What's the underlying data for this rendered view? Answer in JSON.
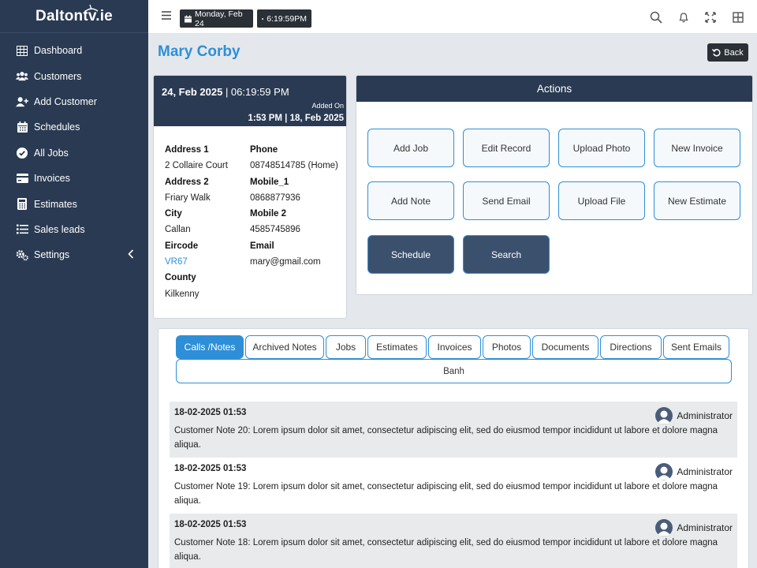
{
  "brand": {
    "name": "Daltontv.ie"
  },
  "sidebar": {
    "items": [
      {
        "label": "Dashboard",
        "icon": "table-icon"
      },
      {
        "label": "Customers",
        "icon": "users-icon"
      },
      {
        "label": "Add Customer",
        "icon": "user-plus-icon"
      },
      {
        "label": "Schedules",
        "icon": "calendar-icon"
      },
      {
        "label": "All Jobs",
        "icon": "check-circle-icon"
      },
      {
        "label": "Invoices",
        "icon": "credit-card-icon"
      },
      {
        "label": "Estimates",
        "icon": "calculator-icon"
      },
      {
        "label": "Sales leads",
        "icon": "list-icon"
      },
      {
        "label": "Settings",
        "icon": "cogs-icon"
      }
    ]
  },
  "topbar": {
    "date": "Monday, Feb 24",
    "time": "6:19:59PM"
  },
  "page": {
    "title": "Mary Corby",
    "back_label": "Back"
  },
  "customer": {
    "header_date": "24, Feb 2025",
    "header_time": " | 06:19:59 PM",
    "added_on_label": "Added On",
    "added_on_value": "1:53 PM | 18, Feb 2025",
    "fields_left": [
      {
        "label": "Address 1",
        "value": "2 Collaire Court"
      },
      {
        "label": "Address 2",
        "value": "Friary Walk"
      },
      {
        "label": "City",
        "value": "Callan"
      },
      {
        "label": "Eircode",
        "value": "VR67"
      },
      {
        "label": "County",
        "value": "Kilkenny"
      }
    ],
    "fields_right": [
      {
        "label": "Phone",
        "value": "08748514785 (Home)"
      },
      {
        "label": "Mobile_1",
        "value": "0868877936"
      },
      {
        "label": "Mobile 2",
        "value": "4585745896"
      },
      {
        "label": "Email",
        "value": "mary@gmail.com"
      }
    ]
  },
  "actions": {
    "title": "Actions",
    "buttons": [
      "Add Job",
      "Edit Record",
      "Upload Photo",
      "New Invoice",
      "Add Note",
      "Send Email",
      "Upload File",
      "New Estimate",
      "Schedule",
      "Search"
    ]
  },
  "tabs": {
    "items": [
      "Calls /Notes",
      "Archived Notes",
      "Jobs",
      "Estimates",
      "Invoices",
      "Photos",
      "Documents",
      "Directions",
      "Sent Emails"
    ],
    "extra": "Banh"
  },
  "notes": [
    {
      "date": "18-02-2025 01:53",
      "author": "Administrator",
      "text": "Customer Note 20: Lorem ipsum dolor sit amet, consectetur adipiscing elit, sed do eiusmod tempor incididunt ut labore et dolore magna aliqua."
    },
    {
      "date": "18-02-2025 01:53",
      "author": "Administrator",
      "text": "Customer Note 19: Lorem ipsum dolor sit amet, consectetur adipiscing elit, sed do eiusmod tempor incididunt ut labore et dolore magna aliqua."
    },
    {
      "date": "18-02-2025 01:53",
      "author": "Administrator",
      "text": "Customer Note 18: Lorem ipsum dolor sit amet, consectetur adipiscing elit, sed do eiusmod tempor incididunt ut labore et dolore magna aliqua."
    }
  ],
  "colors": {
    "sidebar": "#2a3a52",
    "accent": "#2e8fd8",
    "dark_button": "#3b506d"
  }
}
